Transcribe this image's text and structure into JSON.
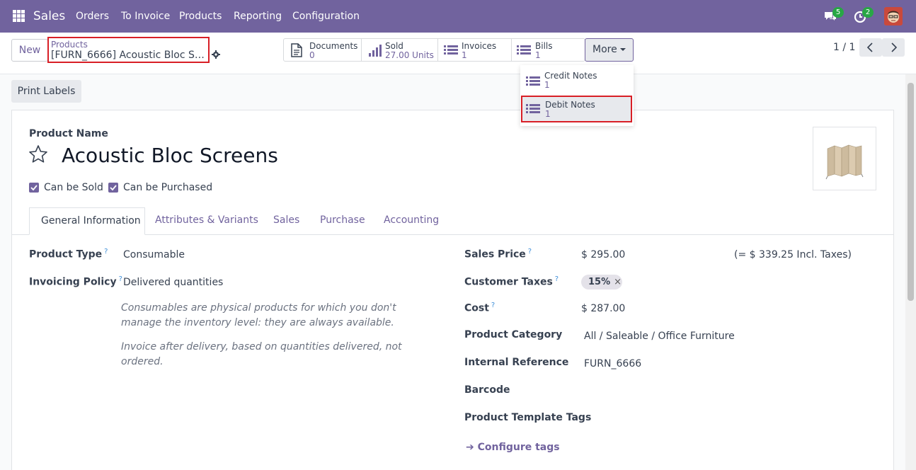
{
  "navbar": {
    "app_name": "Sales",
    "menu": [
      "Orders",
      "To Invoice",
      "Products",
      "Reporting",
      "Configuration"
    ],
    "messages_count": "5",
    "activities_count": "2",
    "bg_color": "#71639e"
  },
  "control_panel": {
    "new_label": "New",
    "breadcrumb_parent": "Products",
    "breadcrumb_current": "[FURN_6666] Acoustic Bloc Screens",
    "smart_buttons": [
      {
        "label": "Documents",
        "value": "0",
        "icon": "file-icon"
      },
      {
        "label": "Sold",
        "value": "27.00 Units",
        "icon": "bar-chart-icon"
      },
      {
        "label": "Invoices",
        "value": "1",
        "icon": "list-icon"
      },
      {
        "label": "Bills",
        "value": "1",
        "icon": "list-icon"
      }
    ],
    "more_label": "More",
    "pager": "1 / 1"
  },
  "more_dropdown": [
    {
      "label": "Credit Notes",
      "value": "1"
    },
    {
      "label": "Debit Notes",
      "value": "1"
    }
  ],
  "actions": {
    "print_labels": "Print Labels"
  },
  "form": {
    "product_name_label": "Product Name",
    "product_name": "Acoustic Bloc Screens",
    "can_be_sold": "Can be Sold",
    "can_be_purchased": "Can be Purchased",
    "tabs": [
      "General Information",
      "Attributes & Variants",
      "Sales",
      "Purchase",
      "Accounting"
    ],
    "left": {
      "product_type_label": "Product Type",
      "product_type": "Consumable",
      "invoicing_policy_label": "Invoicing Policy",
      "invoicing_policy": "Delivered quantities",
      "help_1": "Consumables are physical products for which you don't manage the inventory level: they are always available.",
      "help_2": "Invoice after delivery, based on quantities delivered, not ordered."
    },
    "right": {
      "sales_price_label": "Sales Price",
      "sales_price": "$ 295.00",
      "incl_taxes": "(= $ 339.25 Incl. Taxes)",
      "customer_taxes_label": "Customer Taxes",
      "tax_tag": "15%",
      "cost_label": "Cost",
      "cost": "$ 287.00",
      "category_label": "Product Category",
      "category": "All / Saleable / Office Furniture",
      "internal_ref_label": "Internal Reference",
      "internal_ref": "FURN_6666",
      "barcode_label": "Barcode",
      "template_tags_label": "Product Template Tags",
      "configure_tags": "Configure tags"
    },
    "help_mark": "?"
  }
}
